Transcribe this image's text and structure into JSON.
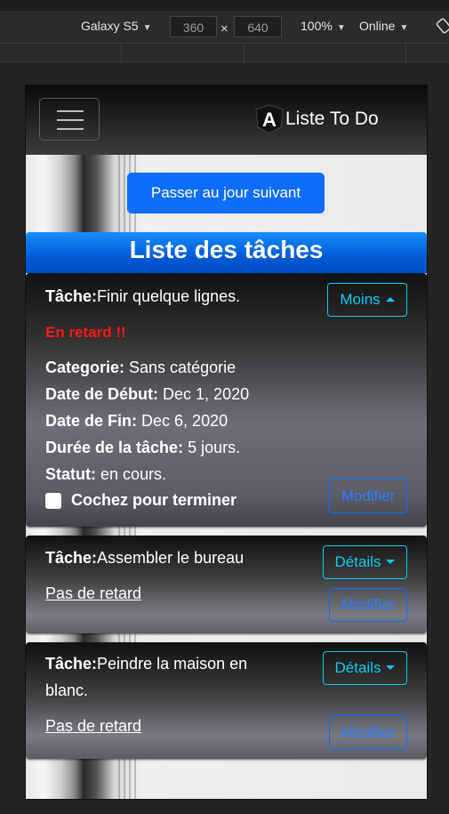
{
  "devtools": {
    "device": "Galaxy S5",
    "width": "360",
    "height": "640",
    "times": "×",
    "zoom": "100%",
    "network": "Online"
  },
  "navbar": {
    "brand": "Liste To Do",
    "brand_logo_letter": "A"
  },
  "next_day_button": "Passer au jour suivant",
  "list_title": "Liste des tâches",
  "tasks": [
    {
      "label": "Tâche:",
      "name": "Finir quelque lignes.",
      "toggle": "Moins",
      "late": "En retard !!",
      "category_label": "Categorie:",
      "category": "Sans catégorie",
      "start_label": "Date de Début:",
      "start": "Dec 1, 2020",
      "end_label": "Date de Fin:",
      "end": "Dec 6, 2020",
      "duration_label": "Durée de la tâche:",
      "duration": "5 jours.",
      "status_label": "Statut:",
      "status": "en cours.",
      "complete_label": "Cochez pour terminer",
      "edit": "Modifier"
    },
    {
      "label": "Tâche:",
      "name": "Assembler le bureau",
      "toggle": "Détails",
      "late": "Pas de retard",
      "edit": "Modifier"
    },
    {
      "label": "Tâche:",
      "name_line1": "Peindre la maison en",
      "name_line2": "blanc.",
      "toggle": "Détails",
      "late": "Pas de retard",
      "edit": "Modifier"
    }
  ]
}
